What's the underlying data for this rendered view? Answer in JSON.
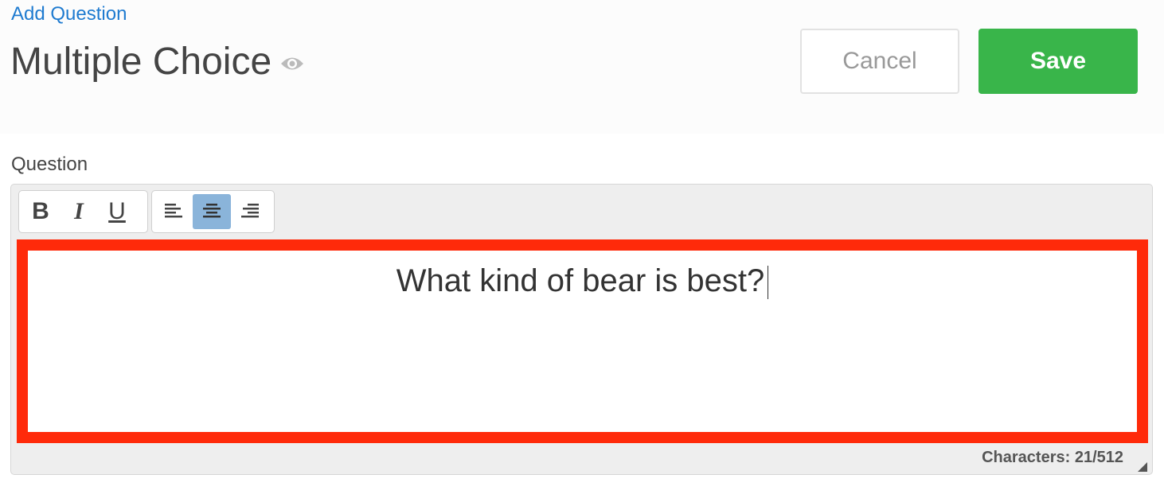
{
  "header": {
    "breadcrumb_link": "Add Question",
    "title": "Multiple Choice",
    "preview_icon": "eye-icon"
  },
  "actions": {
    "cancel_label": "Cancel",
    "save_label": "Save"
  },
  "colors": {
    "link": "#1f7bd0",
    "save": "#39b54a",
    "highlight_border": "#ff2a0a",
    "active_tool": "#8ab4da"
  },
  "question": {
    "label": "Question",
    "toolbar": {
      "format": [
        {
          "label": "B",
          "name": "bold"
        },
        {
          "label": "I",
          "name": "italic"
        },
        {
          "label": "U",
          "name": "underline"
        }
      ],
      "align": [
        {
          "icon": "align-left-icon"
        },
        {
          "icon": "align-center-icon",
          "active": true
        },
        {
          "icon": "align-right-icon"
        }
      ]
    },
    "text": "What kind of bear is best?",
    "char_count": "Characters: 21/512"
  }
}
